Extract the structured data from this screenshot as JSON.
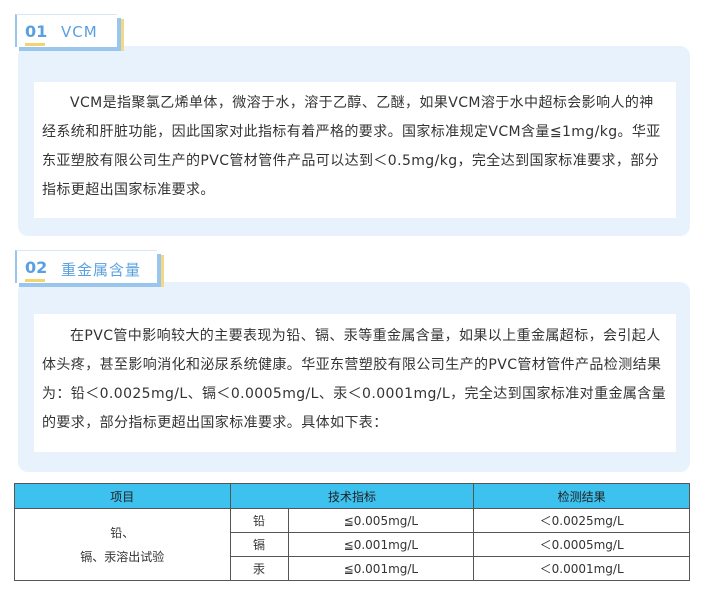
{
  "sections": [
    {
      "number": "01",
      "title": "VCM",
      "paragraph": "VCM是指聚氯乙烯单体，微溶于水，溶于乙醇、乙醚，如果VCM溶于水中超标会影响人的神经系统和肝脏功能，因此国家对此指标有着严格的要求。国家标准规定VCM含量≦1mg/kg。华亚东亚塑胶有限公司生产的PVC管材管件产品可以达到＜0.5mg/kg，完全达到国家标准要求，部分指标更超出国家标准要求。"
    },
    {
      "number": "02",
      "title": "重金属含量",
      "paragraph": "在PVC管中影响较大的主要表现为铅、镉、汞等重金属含量，如果以上重金属超标，会引起人体头疼，甚至影响消化和泌尿系统健康。华亚东营塑胶有限公司生产的PVC管材管件产品检测结果为：铅＜0.0025mg/L、镉＜0.0005mg/L、汞＜0.0001mg/L，完全达到国家标准对重金属含量的要求，部分指标更超出国家标准要求。具体如下表："
    }
  ],
  "table": {
    "headers": [
      "项目",
      "技术指标",
      "检测结果"
    ],
    "item_line1": "铅、",
    "item_line2": "镉、汞溶出试验",
    "rows": [
      {
        "element": "铅",
        "spec": "≦0.005mg/L",
        "result": "＜0.0025mg/L"
      },
      {
        "element": "镉",
        "spec": "≦0.001mg/L",
        "result": "＜0.0005mg/L"
      },
      {
        "element": "汞",
        "spec": "≦0.001mg/L",
        "result": "＜0.0001mg/L"
      }
    ]
  }
}
